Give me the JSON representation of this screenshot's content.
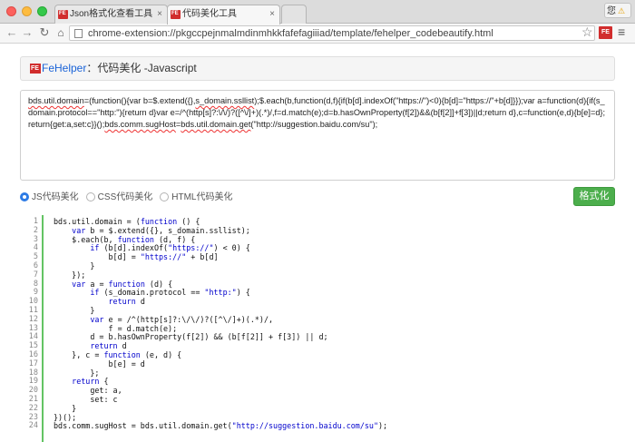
{
  "browser": {
    "tabs": [
      {
        "title": "Json格式化查看工具",
        "active": false
      },
      {
        "title": "代码美化工具",
        "active": true
      }
    ],
    "tab_close_glyph": "×",
    "user_label": "您",
    "url": "chrome-extension://pkgccpejnmalmdinmhkkfafefagiiiad/template/fehelper_codebeautify.html"
  },
  "header": {
    "brand": "FeHelper",
    "sep": "：",
    "title": "代码美化 -Javascript"
  },
  "input": {
    "segments": [
      {
        "text": "bds.util.domain",
        "underline": true
      },
      {
        "text": "=(function(){var b=$.extend({},",
        "underline": false
      },
      {
        "text": "s_domain.ssllist",
        "underline": true
      },
      {
        "text": ");$.each(b,function(d,f){if(b[d].indexOf(\"https://\")<0){b[d]=\"https://\"+b[d]}});var a=function(d){if(s_domain.protocol==\"http:\"){return d}var e=/^(http[s]?:\\/\\/)?([^\\/]+)(.*)/,f=d.match(e);d=b.hasOwnProperty(f[2])&&(b[f[2]]+f[3])||d;return d},c=function(e,d){b[e]=d};return{get:a,set:c}}();",
        "underline": false
      },
      {
        "text": "bds.comm.sugHost",
        "underline": true
      },
      {
        "text": "=",
        "underline": false
      },
      {
        "text": "bds.util.domain.get",
        "underline": true
      },
      {
        "text": "(\"http://suggestion.baidu.com/su\");",
        "underline": false
      }
    ]
  },
  "options": [
    {
      "label": "JS代码美化",
      "selected": true
    },
    {
      "label": "CSS代码美化",
      "selected": false
    },
    {
      "label": "HTML代码美化",
      "selected": false
    }
  ],
  "format_button": "格式化",
  "output": {
    "lines": [
      [
        [
          "bds.util.domain = (",
          ""
        ],
        [
          "function",
          "kw"
        ],
        [
          " () {",
          ""
        ]
      ],
      [
        [
          "    ",
          ""
        ],
        [
          "var",
          "kw"
        ],
        [
          " b = $.extend({}, s_domain.ssllist);",
          ""
        ]
      ],
      [
        [
          "    $.each(b, ",
          ""
        ],
        [
          "function",
          "kw"
        ],
        [
          " (d, f) {",
          ""
        ]
      ],
      [
        [
          "        ",
          ""
        ],
        [
          "if",
          "kw"
        ],
        [
          " (b[d].indexOf(",
          ""
        ],
        [
          "\"https://\"",
          "str"
        ],
        [
          ") < 0) {",
          ""
        ]
      ],
      [
        [
          "            b[d] = ",
          ""
        ],
        [
          "\"https://\"",
          "str"
        ],
        [
          " + b[d]",
          ""
        ]
      ],
      [
        [
          "        }",
          ""
        ]
      ],
      [
        [
          "    });",
          ""
        ]
      ],
      [
        [
          "    ",
          ""
        ],
        [
          "var",
          "kw"
        ],
        [
          " a = ",
          ""
        ],
        [
          "function",
          "kw"
        ],
        [
          " (d) {",
          ""
        ]
      ],
      [
        [
          "        ",
          ""
        ],
        [
          "if",
          "kw"
        ],
        [
          " (s_domain.protocol == ",
          ""
        ],
        [
          "\"http:\"",
          "str"
        ],
        [
          ") {",
          ""
        ]
      ],
      [
        [
          "            ",
          ""
        ],
        [
          "return",
          "kw"
        ],
        [
          " d",
          ""
        ]
      ],
      [
        [
          "        }",
          ""
        ]
      ],
      [
        [
          "        ",
          ""
        ],
        [
          "var",
          "kw"
        ],
        [
          " e = /^(http[s]?:\\/\\/)?([^\\/]+)(.*)/,",
          ""
        ]
      ],
      [
        [
          "            f = d.match(e);",
          ""
        ]
      ],
      [
        [
          "        d = b.hasOwnProperty(f[2]) && (b[f[2]] + f[3]) || d;",
          ""
        ]
      ],
      [
        [
          "        ",
          ""
        ],
        [
          "return",
          "kw"
        ],
        [
          " d",
          ""
        ]
      ],
      [
        [
          "    }, c = ",
          ""
        ],
        [
          "function",
          "kw"
        ],
        [
          " (e, d) {",
          ""
        ]
      ],
      [
        [
          "            b[e] = d",
          ""
        ]
      ],
      [
        [
          "        };",
          ""
        ]
      ],
      [
        [
          "    ",
          ""
        ],
        [
          "return",
          "kw"
        ],
        [
          " {",
          ""
        ]
      ],
      [
        [
          "        get: a,",
          ""
        ]
      ],
      [
        [
          "        set: c",
          ""
        ]
      ],
      [
        [
          "    }",
          ""
        ]
      ],
      [
        [
          "})();",
          ""
        ]
      ],
      [
        [
          "bds.comm.sugHost = bds.util.domain.get(",
          ""
        ],
        [
          "\"http://suggestion.baidu.com/su\"",
          "str"
        ],
        [
          ");",
          ""
        ]
      ]
    ]
  }
}
